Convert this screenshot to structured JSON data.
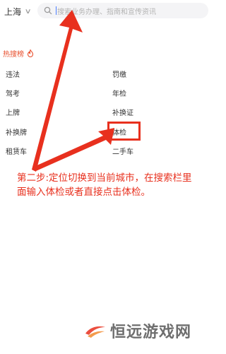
{
  "header": {
    "city": "上海",
    "search_placeholder": "搜索业务办理、指南和宣传资讯"
  },
  "hot": {
    "title": "热搜榜",
    "items": [
      "违法",
      "罚缴",
      "驾考",
      "年检",
      "上牌",
      "补换证",
      "补换牌",
      "体检",
      "租赁车",
      "二手车"
    ]
  },
  "annotation": {
    "instruction": "第二步:定位切换到当前城市，在搜索栏里面输入体检或者直接点击体检。",
    "highlight_color": "#e8301e"
  },
  "watermark": {
    "text": "恒远游戏网"
  },
  "colors": {
    "accent_red": "#e8301e",
    "hot_title": "#e8502e",
    "search_bg": "#f4f4f6",
    "cursor_blue": "#4a7cff"
  }
}
